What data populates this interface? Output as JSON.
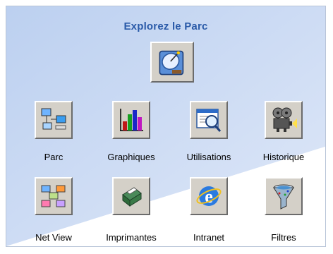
{
  "title": "Explorez le Parc",
  "colors": {
    "title": "#2a5aa8",
    "bg_blue": "#c8d8f4"
  },
  "main_icon": "satellite-dish-icon",
  "items": [
    {
      "label": "Parc",
      "icon": "network-computers-icon"
    },
    {
      "label": "Graphiques",
      "icon": "bar-chart-icon"
    },
    {
      "label": "Utilisations",
      "icon": "window-magnifier-icon"
    },
    {
      "label": "Historique",
      "icon": "film-projector-icon"
    },
    {
      "label": "Net View",
      "icon": "network-view-icon"
    },
    {
      "label": "Imprimantes",
      "icon": "printer-icon"
    },
    {
      "label": "Intranet",
      "icon": "internet-explorer-icon"
    },
    {
      "label": "Filtres",
      "icon": "filter-funnel-icon"
    }
  ]
}
